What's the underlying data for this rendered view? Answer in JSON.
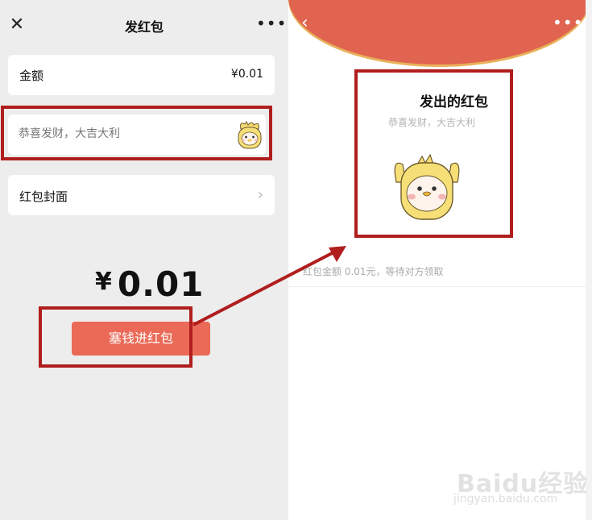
{
  "left": {
    "title": "发红包",
    "amount_label": "金额",
    "amount_value": "¥0.01",
    "greeting_placeholder": "恭喜发财，大吉大利",
    "cover_label": "红包封面",
    "big_amount_symbol": "¥",
    "big_amount_value": "0.01",
    "send_button": "塞钱进红包"
  },
  "right": {
    "title": "发出的红包",
    "greeting": "恭喜发财，大吉大利",
    "status": "红包金额 0.01元，等待对方领取"
  },
  "watermark": {
    "logo": "Baidu经验",
    "url": "jingyan.baidu.com"
  },
  "colors": {
    "accent": "#ea6a57",
    "header_red": "#e06450",
    "highlight": "#b01e1e",
    "panel_bg": "#ededed"
  },
  "icons": [
    "close-icon",
    "more-icon",
    "chevron-right-icon",
    "back-icon",
    "sticker-chick"
  ]
}
